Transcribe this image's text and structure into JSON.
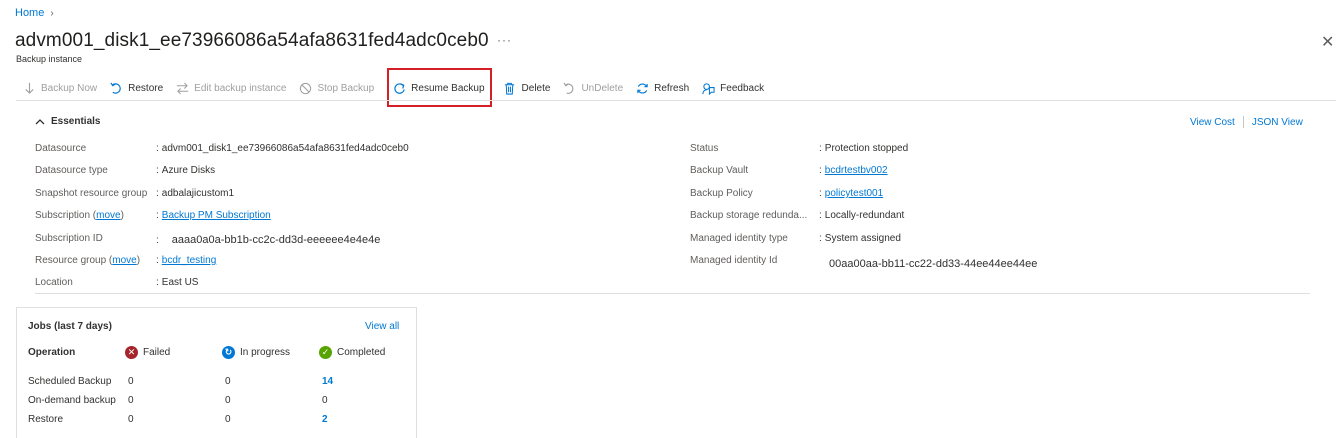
{
  "breadcrumb": {
    "home": "Home",
    "chevron": "›"
  },
  "header": {
    "title": "advm001_disk1_ee73966086a54afa8631fed4adc0ceb0",
    "more": "···",
    "subtitle": "Backup instance",
    "close": "✕"
  },
  "toolbar": {
    "backup_now": "Backup Now",
    "restore": "Restore",
    "edit_backup_instance": "Edit backup instance",
    "stop_backup": "Stop Backup",
    "resume_backup": "Resume Backup",
    "delete": "Delete",
    "undelete": "UnDelete",
    "refresh": "Refresh",
    "feedback": "Feedback"
  },
  "essentials": {
    "heading": "Essentials",
    "view_cost": "View Cost",
    "json_view": "JSON View",
    "left": {
      "datasource": {
        "label": "Datasource",
        "value": "advm001_disk1_ee73966086a54afa8631fed4adc0ceb0"
      },
      "datasource_type": {
        "label": "Datasource type",
        "value": "Azure Disks"
      },
      "snapshot_rg": {
        "label": "Snapshot resource group",
        "value": "adbalajicustom1"
      },
      "subscription": {
        "label": "Subscription",
        "move": "move",
        "value": "Backup PM Subscription"
      },
      "subscription_id": {
        "label": "Subscription ID",
        "value": "aaaa0a0a-bb1b-cc2c-dd3d-eeeeee4e4e4e"
      },
      "resource_group": {
        "label": "Resource group",
        "move": "move",
        "value": "bcdr_testing"
      },
      "location": {
        "label": "Location",
        "value": "East US"
      }
    },
    "right": {
      "status": {
        "label": "Status",
        "value": "Protection stopped"
      },
      "backup_vault": {
        "label": "Backup Vault",
        "value": "bcdrtestbv002"
      },
      "backup_policy": {
        "label": "Backup Policy",
        "value": "policytest001"
      },
      "storage_redundancy": {
        "label": "Backup storage redunda...",
        "value": "Locally-redundant"
      },
      "managed_identity_type": {
        "label": "Managed identity type",
        "value": "System assigned"
      },
      "managed_identity_id": {
        "label": "Managed identity Id",
        "value": "00aa00aa-bb11-cc22-dd33-44ee44ee44ee"
      }
    }
  },
  "jobs": {
    "title": "Jobs (last 7 days)",
    "view_all": "View all",
    "headers": {
      "operation": "Operation",
      "failed": "Failed",
      "in_progress": "In progress",
      "completed": "Completed"
    },
    "rows": [
      {
        "operation": "Scheduled Backup",
        "failed": "0",
        "in_progress": "0",
        "completed": "14"
      },
      {
        "operation": "On-demand backup",
        "failed": "0",
        "in_progress": "0",
        "completed": "0"
      },
      {
        "operation": "Restore",
        "failed": "0",
        "in_progress": "0",
        "completed": "2"
      }
    ]
  },
  "colors": {
    "accent": "#0078d4",
    "highlight": "#d41f26",
    "failed": "#a4262c",
    "in_progress": "#0078d4",
    "completed": "#57a300"
  }
}
